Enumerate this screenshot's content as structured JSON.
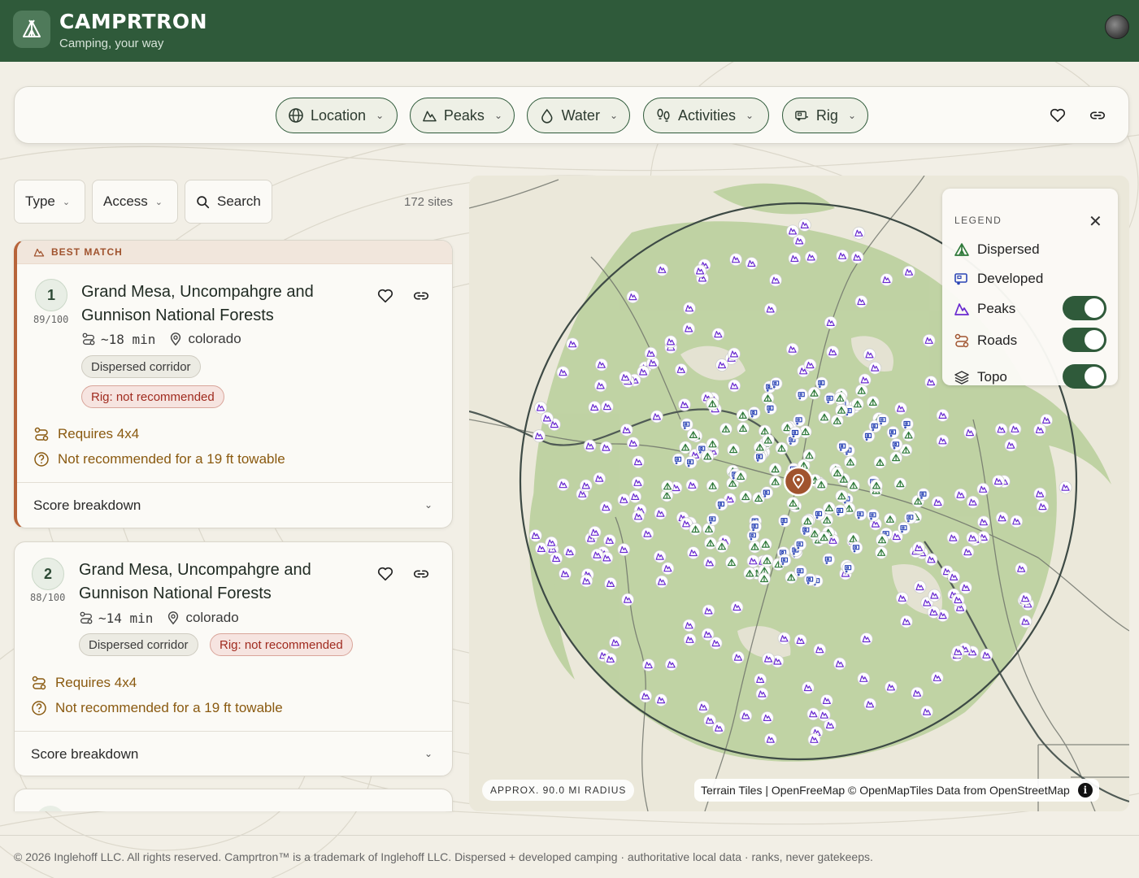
{
  "header": {
    "brand": "CAMPRTRON",
    "tagline": "Camping, your way"
  },
  "filters": {
    "pills": [
      {
        "label": "Location",
        "icon": "globe-icon"
      },
      {
        "label": "Peaks",
        "icon": "mountain-icon"
      },
      {
        "label": "Water",
        "icon": "water-icon"
      },
      {
        "label": "Activities",
        "icon": "footprints-icon"
      },
      {
        "label": "Rig",
        "icon": "rv-icon"
      }
    ]
  },
  "controls": {
    "type_label": "Type",
    "access_label": "Access",
    "search_label": "Search",
    "site_count": "172 sites"
  },
  "results": [
    {
      "badge": "BEST MATCH",
      "rank": "1",
      "score": "89/100",
      "title": "Grand Mesa, Uncompahgre and Gunnison National Forests",
      "drive": "~18 min",
      "state": "colorado",
      "tags": [
        "Dispersed corridor",
        "Rig: not recommended"
      ],
      "notes": [
        "Requires 4x4",
        "Not recommended for a 19 ft towable"
      ],
      "breakdown_label": "Score breakdown"
    },
    {
      "rank": "2",
      "score": "88/100",
      "title": "Grand Mesa, Uncompahgre and Gunnison National Forests",
      "drive": "~14 min",
      "state": "colorado",
      "tags": [
        "Dispersed corridor",
        "Rig: not recommended"
      ],
      "notes": [
        "Requires 4x4",
        "Not recommended for a 19 ft towable"
      ],
      "breakdown_label": "Score breakdown"
    }
  ],
  "map": {
    "legend_title": "LEGEND",
    "legend": [
      {
        "label": "Dispersed",
        "icon": "tent-icon",
        "color": "#2f7a3a"
      },
      {
        "label": "Developed",
        "icon": "rv-icon",
        "color": "#2b45b5"
      },
      {
        "label": "Peaks",
        "icon": "mountain-icon",
        "color": "#6a2bd0",
        "toggle": true
      },
      {
        "label": "Roads",
        "icon": "roads-icon",
        "color": "#a0532e",
        "toggle": true
      },
      {
        "label": "Topo",
        "icon": "layers-icon",
        "color": "#333333",
        "toggle": true
      }
    ],
    "radius_label": "APPROX. 90.0 MI RADIUS",
    "attribution": "Terrain Tiles | OpenFreeMap © OpenMapTiles Data from OpenStreetMap"
  },
  "footer": "© 2026 Inglehoff LLC. All rights reserved. Camprtron™ is a trademark of Inglehoff LLC. Dispersed + developed camping · authoritative local data · ranks, never gatekeeps.",
  "colors": {
    "brand_green": "#2f5a3a",
    "accent_rust": "#b7643a",
    "warn_red": "#a02b1f"
  }
}
